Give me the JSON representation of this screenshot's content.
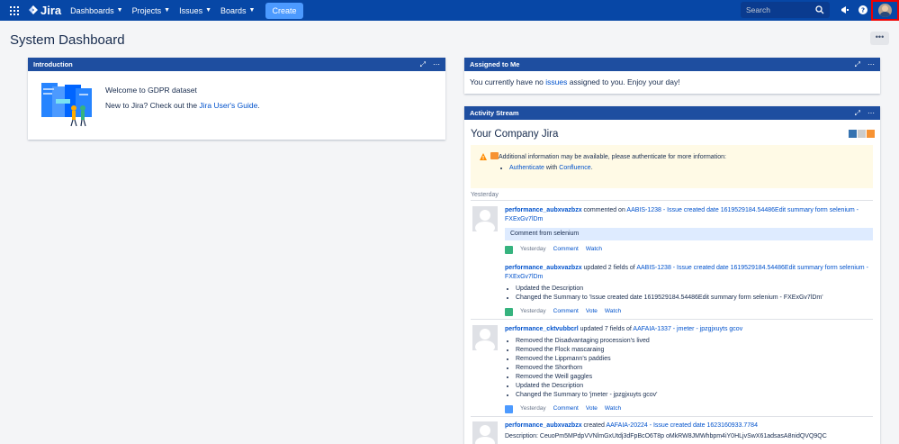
{
  "nav": {
    "logo": "Jira",
    "items": [
      {
        "label": "Dashboards"
      },
      {
        "label": "Projects"
      },
      {
        "label": "Issues"
      },
      {
        "label": "Boards"
      }
    ],
    "create_label": "Create",
    "search_placeholder": "Search"
  },
  "page": {
    "title": "System Dashboard",
    "more_label": "•••"
  },
  "introduction": {
    "header": "Introduction",
    "welcome": "Welcome to GDPR dataset",
    "new_prefix": "New to Jira? Check out the ",
    "guide_link": "Jira User's Guide",
    "suffix": "."
  },
  "assigned": {
    "header": "Assigned to Me",
    "prefix": "You currently have no ",
    "link": "issues",
    "suffix": " assigned to you. Enjoy your day!"
  },
  "activity": {
    "header": "Activity Stream",
    "title": "Your Company Jira",
    "warning": "Additional information may be available, please authenticate for more information:",
    "auth_link": "Authenticate",
    "auth_with": " with ",
    "confluence_link": "Confluence",
    "auth_suffix": ".",
    "day": "Yesterday",
    "entries": [
      {
        "user": "performance_aubxvazbzx",
        "action": " commented on ",
        "issue": "AABIS-1238 - Issue created date 1619529184.54486Edit summary form selenium - FXExGv7lDm",
        "comment": "Comment from selenium",
        "time": "Yesterday",
        "links": [
          "Comment",
          "Watch"
        ]
      },
      {
        "user": "performance_aubxvazbzx",
        "action": " updated 2 fields of ",
        "issue": "AABIS-1238 - Issue created date 1619529184.54486Edit summary form selenium - FXExGv7lDm",
        "changes": [
          "Updated the Description",
          "Changed the Summary to 'Issue created date 1619529184.54486Edit summary form selenium - FXExGv7lDm'"
        ],
        "time": "Yesterday",
        "links": [
          "Comment",
          "Vote",
          "Watch"
        ]
      },
      {
        "user": "performance_cktvubbcrl",
        "action": " updated 7 fields of ",
        "issue": "AAFAIA-1337 - jmeter - jpzgjxuyts gcov",
        "changes": [
          "Removed the Disadvantaging procession's lived",
          "Removed the Flock mascaraing",
          "Removed the Lippmann's paddies",
          "Removed the Shorthorn",
          "Removed the Weill gaggles",
          "Updated the Description",
          "Changed the Summary to 'jmeter - jpzgjxuyts gcov'"
        ],
        "time": "Yesterday",
        "links": [
          "Comment",
          "Vote",
          "Watch"
        ]
      },
      {
        "user": "performance_aubxvazbzx",
        "action": " created ",
        "issue": "AAFAIA-20224 - Issue created date 1623160933.7784",
        "description": "Description: CeuoPm5MPdpVVNlmGxUtdj3dFpBcO6T8p oMkRW8JMWhbpm4iY0HLjvSwX61adsasA8nidQVQ9QC"
      }
    ]
  },
  "colors": {
    "nav_bg": "#0747a6",
    "gadget_header": "#1e4ea0",
    "link": "#0052cc",
    "create": "#4c9aff",
    "highlight_border": "#ee0000"
  }
}
